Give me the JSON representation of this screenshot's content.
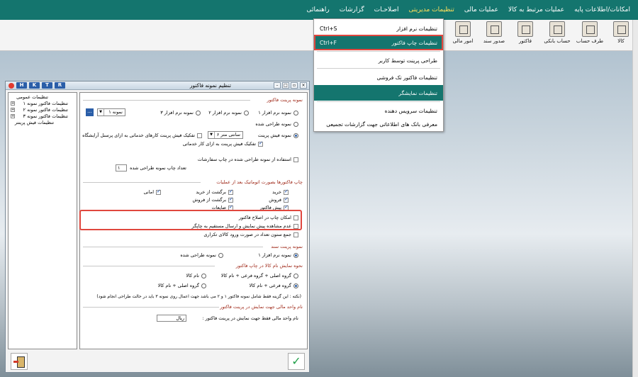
{
  "menubar": {
    "items": [
      "امکانات/اطلاعات پایه",
      "عملیات مرتبط به کالا",
      "عملیات مالی",
      "تنظیمات مدیریتی",
      "اصلاحـات",
      "گزارشات",
      "راهنمائی"
    ],
    "active_index": 3
  },
  "toolbar": {
    "items": [
      "کالا",
      "طرف حساب",
      "حساب بانکی",
      "فاکتور",
      "صدور سند",
      "امور مالی"
    ]
  },
  "dropdown": {
    "items": [
      {
        "label": "تنظیمات نرم افزار",
        "shortcut": "Ctrl+S"
      },
      {
        "label": "تنظیمات چاپ فاکتور",
        "shortcut": "Ctrl+F"
      },
      {
        "label": "طراحی پرینت توسط کاربر",
        "shortcut": ""
      },
      {
        "label": "تنظیمات فاکتور تک فروشی",
        "shortcut": ""
      },
      {
        "label": "تنظیمات نمایشگر",
        "shortcut": ""
      },
      {
        "label": "تنظیمات سرویس دهنده",
        "shortcut": ""
      },
      {
        "label": "معرفی بانک های اطلاعاتی جهت گزارشات تجمیعی",
        "shortcut": ""
      }
    ]
  },
  "window": {
    "title": "تنظیم نمونه فاکتور",
    "hk_buttons": [
      "H",
      "K",
      "T",
      "R"
    ]
  },
  "tree": {
    "items": [
      "تنظیمات عمومی",
      "تنظیمات فاکتور نمونه ۱",
      "تنظیمات فاکتور نمونه ۲",
      "تنظیمات فاکتور نمونه ۳",
      "تنظیمات فیش پرینتر"
    ]
  },
  "panel": {
    "sec_invoice_sample": "نمونه پرینت فاکتور",
    "opt_sample1": "نمونه نرم افزار ۱",
    "opt_sample2": "نمونه نرم افزار ۲",
    "opt_sample3": "نمونه نرم افزار ۳",
    "opt_designed": "نمونه طراحی شده",
    "sel_sample": "نمونه ۱",
    "ellipsis": "...",
    "opt_receipt": "نمونه فیش پرینت",
    "sel_receipt": "سانتی متر ۶",
    "chk_service_staff": "تفکیک فیش پرینت کارهای خدماتی به ازای پرسنل آرایشگاه",
    "chk_service_job": "تفکیک فیش پرینت به ازای کار خدماتی",
    "chk_use_designed": "استفاده از نمونه طراحی شده در چاپ سفارشات",
    "copies_label": "تعداد چاپ نمونه طراحی شده",
    "copies_value": "۱",
    "sec_auto_print": "چاپ فاکتورها بصورت اتوماتیک بعد از عملیات",
    "chk_purchase": "خرید",
    "chk_sales": "فروش",
    "chk_presale": "پیش فاکتور",
    "chk_return_purchase": "برگشت از خرید",
    "chk_return_sales": "برگشت از فروش",
    "chk_waste": "ضایعات",
    "chk_consignment": "امانی",
    "chk_print_edit": "امکان چاپ در اصلاح فاکتور",
    "chk_no_preview": "عدم مشاهده پیش نمایش و ارسال مستقیم به چاپگر",
    "chk_sum_qty": "جمع ستون تعداد در صورت ورود کالای تکراری",
    "sec_voucher_sample": "نمونه پرینت سند",
    "opt_voucher_sw": "نمونه نرم افزار ۱",
    "opt_voucher_designed": "نمونه طراحی شده",
    "sec_name_display": "نحوه نمایش نام کالا در چاپ فاکتور",
    "opt_n1": "گروه اصلی + گروه فرعی + نام کالا",
    "opt_n2": "نام کالا",
    "opt_n3": "گروه فرعی + نام کالا",
    "opt_n4": "گروه اصلی + نام کالا",
    "note": "(نکته : این گزینه فقط شامل نمونه فاکتور ۱ و ۲ می باشد جهت اعمال روی نمونه ۳ باید در حالت طراحی انجام شود)",
    "sec_currency": "نام واحد مالی جهت نمایش در پرینت فاکتور",
    "currency_label": "نام واحد مالی فقط جهت نمایش در پرینت فاکتور :",
    "currency_value": "ریال"
  },
  "colors": {
    "menubar": "#14756e",
    "highlight": "#14756e",
    "active_menu": "#ffe05a",
    "callout": "#e0473e"
  }
}
